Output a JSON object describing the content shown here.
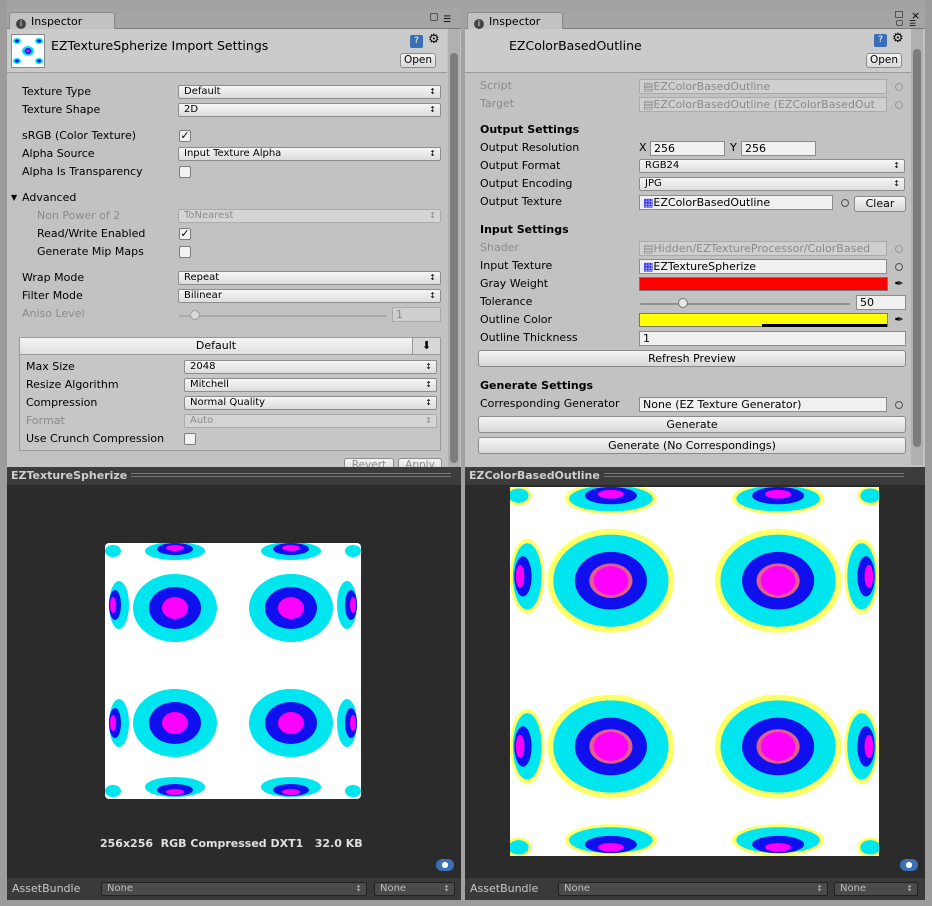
{
  "left": {
    "tab_title": "Inspector",
    "asset_title": "EZTextureSpherize Import Settings",
    "open_label": "Open",
    "fields": {
      "texture_type": {
        "label": "Texture Type",
        "value": "Default"
      },
      "texture_shape": {
        "label": "Texture Shape",
        "value": "2D"
      },
      "srgb": {
        "label": "sRGB (Color Texture)",
        "checked": true
      },
      "alpha_source": {
        "label": "Alpha Source",
        "value": "Input Texture Alpha"
      },
      "alpha_transparency": {
        "label": "Alpha Is Transparency",
        "checked": false
      },
      "advanced": {
        "label": "Advanced"
      },
      "non_power_of_2": {
        "label": "Non Power of 2",
        "value": "ToNearest"
      },
      "read_write": {
        "label": "Read/Write Enabled",
        "checked": true
      },
      "mip_maps": {
        "label": "Generate Mip Maps",
        "checked": false
      },
      "wrap_mode": {
        "label": "Wrap Mode",
        "value": "Repeat"
      },
      "filter_mode": {
        "label": "Filter Mode",
        "value": "Bilinear"
      },
      "aniso_level": {
        "label": "Aniso Level",
        "value": "1"
      }
    },
    "platform": {
      "tab_label": "Default",
      "max_size": {
        "label": "Max Size",
        "value": "2048"
      },
      "resize_algorithm": {
        "label": "Resize Algorithm",
        "value": "Mitchell"
      },
      "compression": {
        "label": "Compression",
        "value": "Normal Quality"
      },
      "format": {
        "label": "Format",
        "value": "Auto"
      },
      "crunch": {
        "label": "Use Crunch Compression",
        "checked": false
      }
    },
    "revert_label": "Revert",
    "apply_label": "Apply",
    "preview_title": "EZTextureSpherize",
    "preview_info": "256x256  RGB Compressed DXT1   32.0 KB",
    "assetbundle_label": "AssetBundle",
    "assetbundle_value": "None",
    "variant_value": "None"
  },
  "right": {
    "tab_title": "Inspector",
    "asset_title": "EZColorBasedOutline",
    "open_label": "Open",
    "script": {
      "label": "Script",
      "value": "EZColorBasedOutline"
    },
    "target": {
      "label": "Target",
      "value": "EZColorBasedOutline (EZColorBasedOut"
    },
    "output_header": "Output Settings",
    "output_resolution": {
      "label": "Output Resolution",
      "x_label": "X",
      "x": "256",
      "y_label": "Y",
      "y": "256"
    },
    "output_format": {
      "label": "Output Format",
      "value": "RGB24"
    },
    "output_encoding": {
      "label": "Output Encoding",
      "value": "JPG"
    },
    "output_texture": {
      "label": "Output Texture",
      "value": "EZColorBasedOutline",
      "clear_label": "Clear"
    },
    "input_header": "Input Settings",
    "shader": {
      "label": "Shader",
      "value": "Hidden/EZTextureProcessor/ColorBased"
    },
    "input_texture": {
      "label": "Input Texture",
      "value": "EZTextureSpherize"
    },
    "gray_weight": {
      "label": "Gray Weight",
      "color": "#ff0000"
    },
    "tolerance": {
      "label": "Tolerance",
      "value": "50",
      "fraction": 0.2
    },
    "outline_color": {
      "label": "Outline Color",
      "color": "#ffff00"
    },
    "outline_thickness": {
      "label": "Outline Thickness",
      "value": "1"
    },
    "refresh_label": "Refresh Preview",
    "generate_header": "Generate Settings",
    "generator": {
      "label": "Corresponding Generator",
      "value": "None (EZ Texture Generator)"
    },
    "generate_label": "Generate",
    "generate_no_corr_label": "Generate (No Correspondings)",
    "preview_title": "EZColorBasedOutline",
    "assetbundle_label": "AssetBundle",
    "assetbundle_value": "None",
    "variant_value": "None"
  }
}
